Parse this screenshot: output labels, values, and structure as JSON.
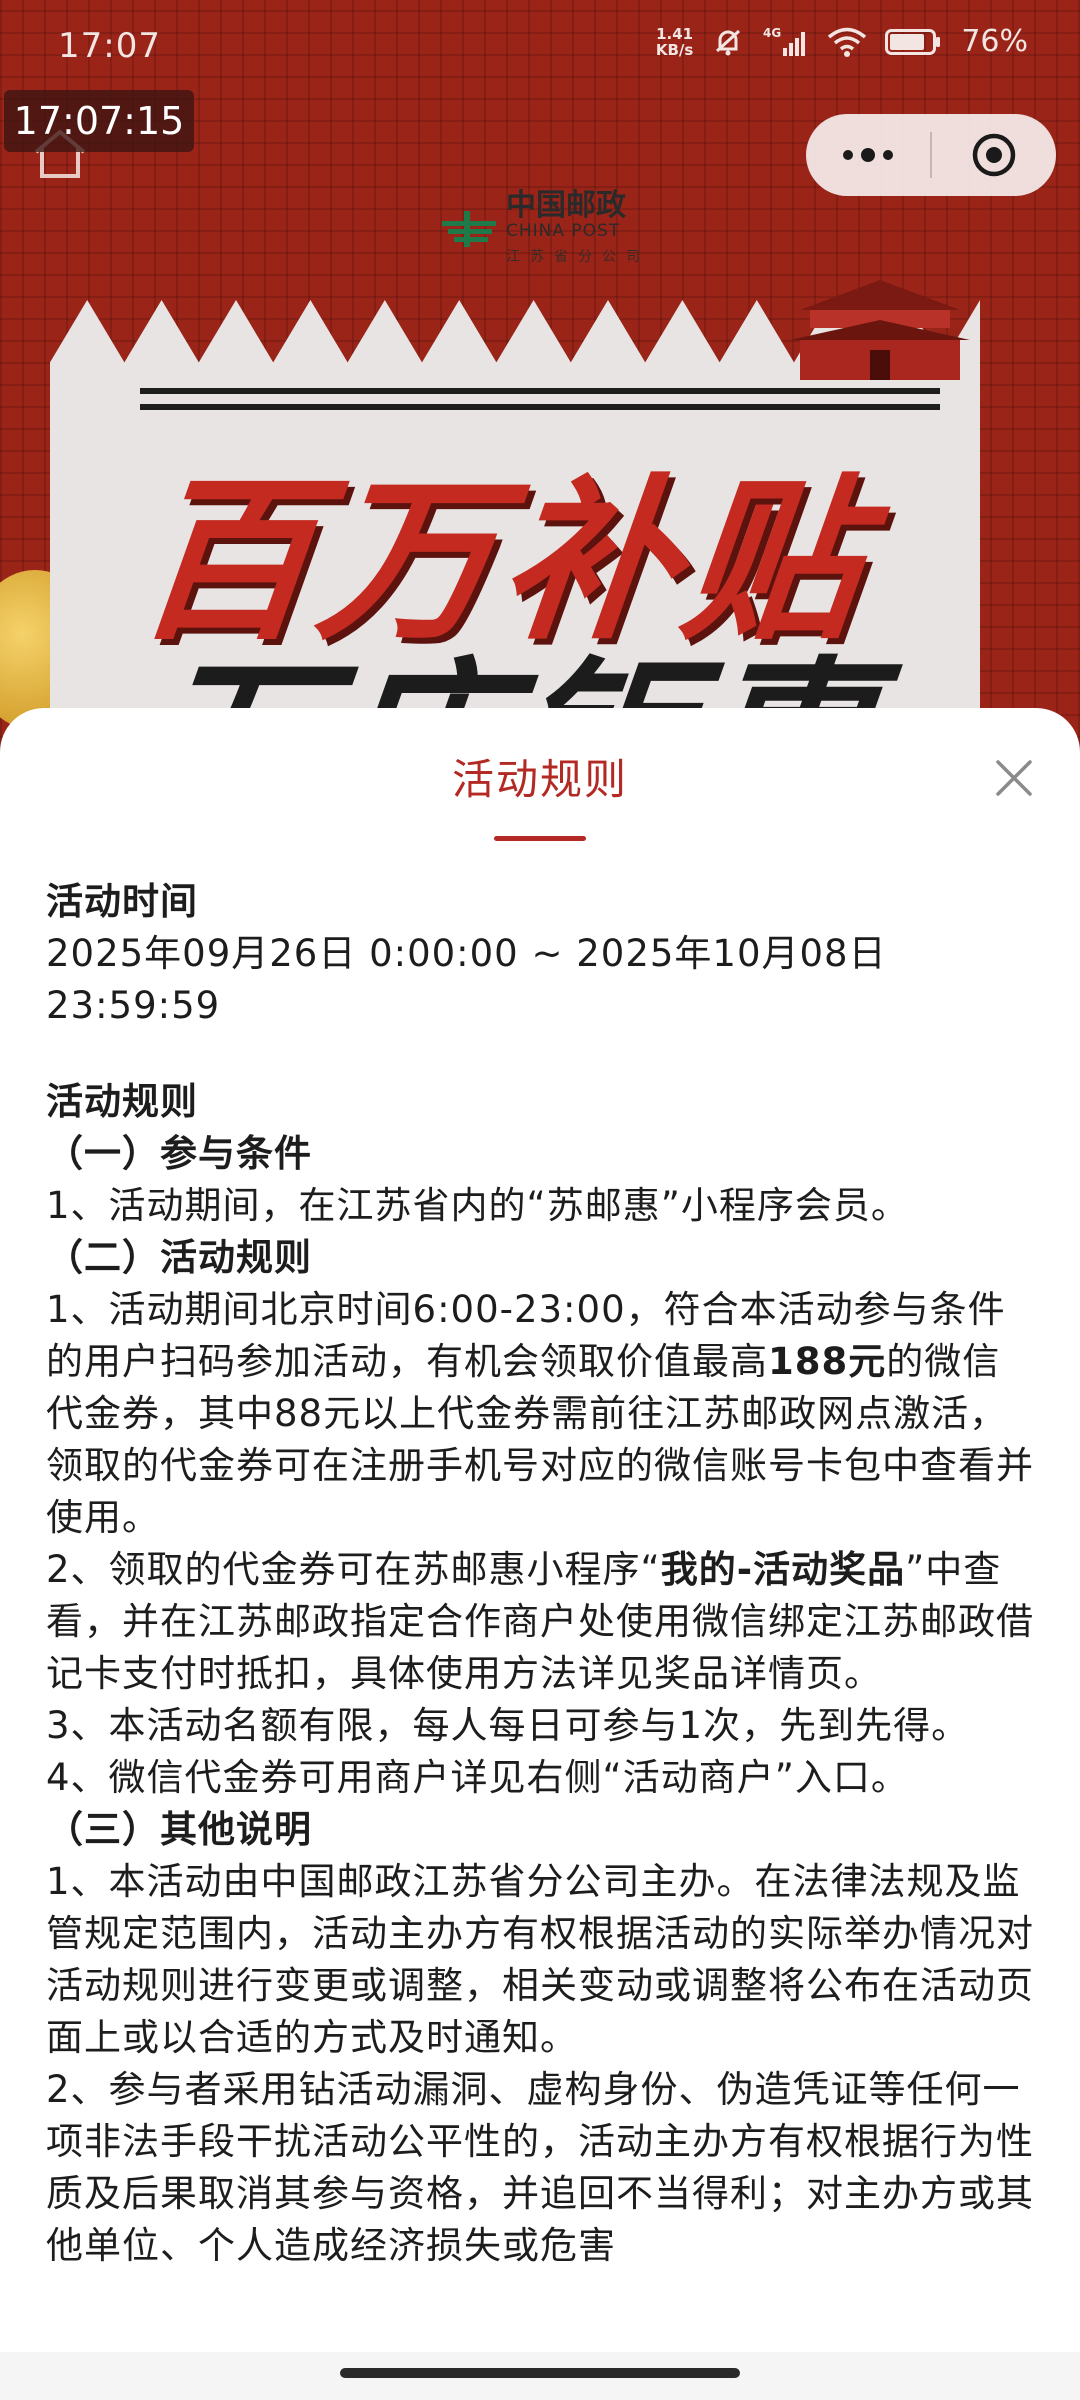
{
  "status_bar": {
    "time": "17:07",
    "net_speed_value": "1.41",
    "net_speed_unit": "KB/s",
    "network": "4G",
    "battery": "76%"
  },
  "overlay_clock": "17:07:15",
  "poster": {
    "logo_cn": "中国邮政",
    "logo_en": "CHINA POST",
    "logo_sub": "江苏省分公司",
    "title_line1": "百万补贴",
    "title_line2": "万店钜惠"
  },
  "sheet": {
    "title": "活动规则",
    "time_heading": "活动时间",
    "time_range_line1": "2025年09月26日 0:00:00 ~ 2025年10月08日",
    "time_range_line2": "23:59:59",
    "rules_heading": "活动规则",
    "section1_title": "（一）参与条件",
    "section1_item1": "1、活动期间，在江苏省内的“苏邮惠”小程序会员。",
    "section2_title": "（二）活动规则",
    "section2_item1_a": "1、活动期间北京时间6:00-23:00，符合本活动参与条件的用户扫码参加活动，有机会领取价值最高",
    "section2_item1_bold": "188元",
    "section2_item1_b": "的微信代金券，其中88元以上代金券需前往江苏邮政网点激活，领取的代金券可在注册手机号对应的微信账号卡包中查看并使用。",
    "section2_item2_a": "2、领取的代金券可在苏邮惠小程序“",
    "section2_item2_bold": "我的-活动奖品",
    "section2_item2_b": "”中查看，并在江苏邮政指定合作商户处使用微信绑定江苏邮政借记卡支付时抵扣，具体使用方法详见奖品详情页。",
    "section2_item3": "3、本活动名额有限，每人每日可参与1次，先到先得。",
    "section2_item4": "4、微信代金券可用商户详见右侧“活动商户”入口。",
    "section3_title": "（三）其他说明",
    "section3_item1": "1、本活动由中国邮政江苏省分公司主办。在法律法规及监管规定范围内，活动主办方有权根据活动的实际举办情况对活动规则进行变更或调整，相关变动或调整将公布在活动页面上或以合适的方式及时通知。",
    "section3_item2": "2、参与者采用钻活动漏洞、虚构身份、伪造凭证等任何一项非法手段干扰活动公平性的，活动主办方有权根据行为性质及后果取消其参与资格，并追回不当得利；对主办方或其他单位、个人造成经济损失或危害"
  },
  "colors": {
    "accent": "#b32a24",
    "poster_red": "#9b2419"
  },
  "icons": {
    "home": "home-icon",
    "more": "more-dots-icon",
    "capsule_close": "target-circle-icon",
    "sheet_close": "close-icon"
  }
}
